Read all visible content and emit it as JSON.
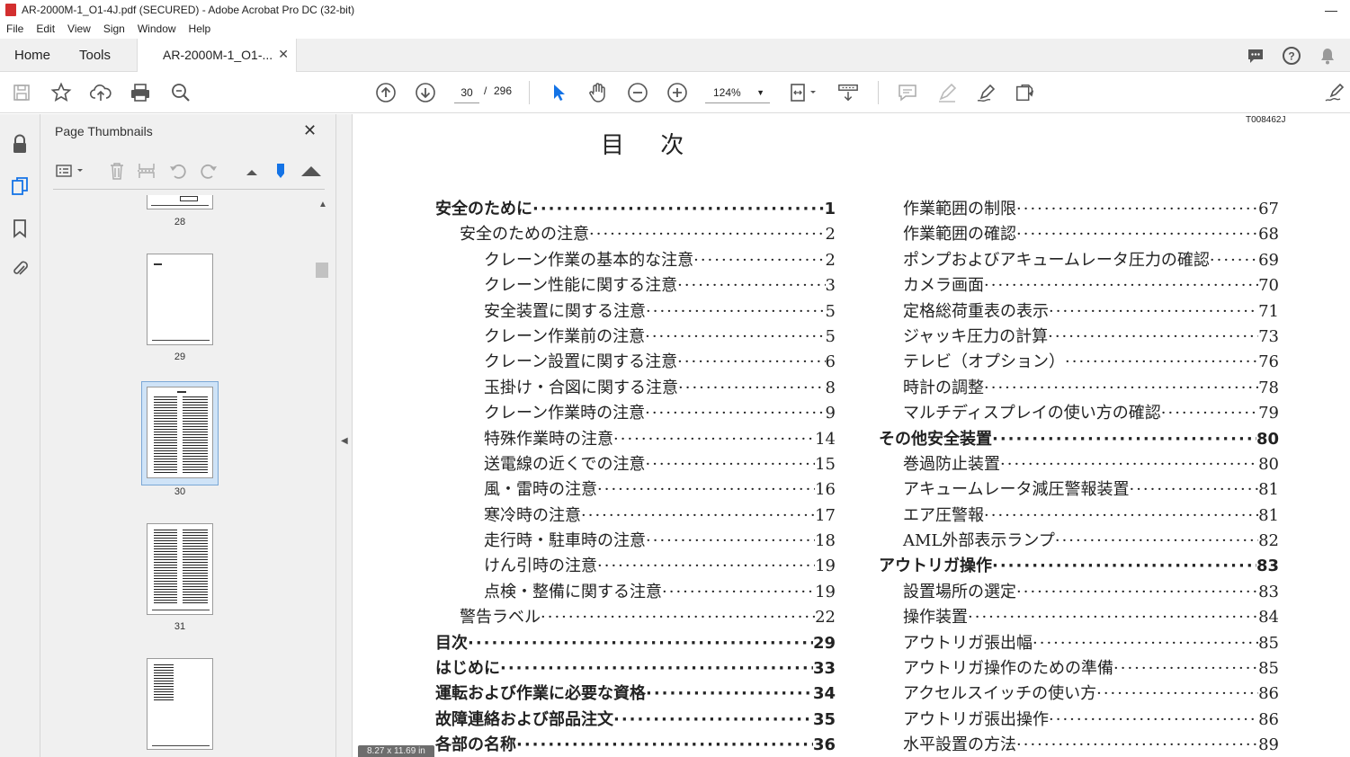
{
  "window": {
    "title": "AR-2000M-1_O1-4J.pdf (SECURED) - Adobe Acrobat Pro DC (32-bit)"
  },
  "menu": [
    "File",
    "Edit",
    "View",
    "Sign",
    "Window",
    "Help"
  ],
  "tabs": {
    "home": "Home",
    "tools": "Tools",
    "doc": "AR-2000M-1_O1-..."
  },
  "toolbar": {
    "page_current": "30",
    "page_sep": "/",
    "page_total": "296",
    "zoom": "124%"
  },
  "panel": {
    "title": "Page Thumbnails"
  },
  "thumbnails": [
    {
      "label": "28"
    },
    {
      "label": "29"
    },
    {
      "label": "30",
      "selected": true
    },
    {
      "label": "31"
    }
  ],
  "document": {
    "doc_id": "T008462J",
    "title": "目 次",
    "size_indicator": "8.27 x 11.69 in",
    "toc_left": [
      {
        "text": "安全のために",
        "page": "1",
        "level": 0
      },
      {
        "text": "安全のための注意",
        "page": "2",
        "level": 1
      },
      {
        "text": "クレーン作業の基本的な注意",
        "page": "2",
        "level": 2
      },
      {
        "text": "クレーン性能に関する注意",
        "page": "3",
        "level": 2
      },
      {
        "text": "安全装置に関する注意",
        "page": "5",
        "level": 2
      },
      {
        "text": "クレーン作業前の注意",
        "page": "5",
        "level": 2
      },
      {
        "text": "クレーン設置に関する注意",
        "page": "6",
        "level": 2
      },
      {
        "text": "玉掛け・合図に関する注意",
        "page": "8",
        "level": 2
      },
      {
        "text": "クレーン作業時の注意",
        "page": "9",
        "level": 2
      },
      {
        "text": "特殊作業時の注意",
        "page": "14",
        "level": 2
      },
      {
        "text": "送電線の近くでの注意",
        "page": "15",
        "level": 2
      },
      {
        "text": "風・雷時の注意",
        "page": "16",
        "level": 2
      },
      {
        "text": "寒冷時の注意",
        "page": "17",
        "level": 2
      },
      {
        "text": "走行時・駐車時の注意",
        "page": "18",
        "level": 2
      },
      {
        "text": "けん引時の注意",
        "page": "19",
        "level": 2
      },
      {
        "text": "点検・整備に関する注意",
        "page": "19",
        "level": 2
      },
      {
        "text": "警告ラベル",
        "page": "22",
        "level": 1
      },
      {
        "text": "目次",
        "page": "29",
        "level": 0
      },
      {
        "text": "はじめに",
        "page": "33",
        "level": 0
      },
      {
        "text": "運転および作業に必要な資格",
        "page": "34",
        "level": 0
      },
      {
        "text": "故障連絡および部品注文",
        "page": "35",
        "level": 0
      },
      {
        "text": "各部の名称",
        "page": "36",
        "level": 0
      }
    ],
    "toc_right": [
      {
        "text": "作業範囲の制限",
        "page": "67",
        "level": 1
      },
      {
        "text": "作業範囲の確認",
        "page": "68",
        "level": 1
      },
      {
        "text": "ポンプおよびアキュームレータ圧力の確認",
        "page": "69",
        "level": 1
      },
      {
        "text": "カメラ画面",
        "page": "70",
        "level": 1
      },
      {
        "text": "定格総荷重表の表示",
        "page": "71",
        "level": 1
      },
      {
        "text": "ジャッキ圧力の計算",
        "page": "73",
        "level": 1
      },
      {
        "text": "テレビ（オプション）",
        "page": "76",
        "level": 1
      },
      {
        "text": "時計の調整",
        "page": "78",
        "level": 1
      },
      {
        "text": "マルチディスプレイの使い方の確認",
        "page": "79",
        "level": 1
      },
      {
        "text": "その他安全装置",
        "page": "80",
        "level": 0
      },
      {
        "text": "巻過防止装置",
        "page": "80",
        "level": 1
      },
      {
        "text": "アキュームレータ減圧警報装置",
        "page": "81",
        "level": 1
      },
      {
        "text": "エア圧警報",
        "page": "81",
        "level": 1
      },
      {
        "text": "AML外部表示ランプ",
        "page": "82",
        "level": 1
      },
      {
        "text": "アウトリガ操作",
        "page": "83",
        "level": 0
      },
      {
        "text": "設置場所の選定",
        "page": "83",
        "level": 1
      },
      {
        "text": "操作装置",
        "page": "84",
        "level": 1
      },
      {
        "text": "アウトリガ張出幅",
        "page": "85",
        "level": 1
      },
      {
        "text": "アウトリガ操作のための準備",
        "page": "85",
        "level": 1
      },
      {
        "text": "アクセルスイッチの使い方",
        "page": "86",
        "level": 1
      },
      {
        "text": "アウトリガ張出操作",
        "page": "86",
        "level": 1
      },
      {
        "text": "水平設置の方法",
        "page": "89",
        "level": 1
      }
    ]
  }
}
